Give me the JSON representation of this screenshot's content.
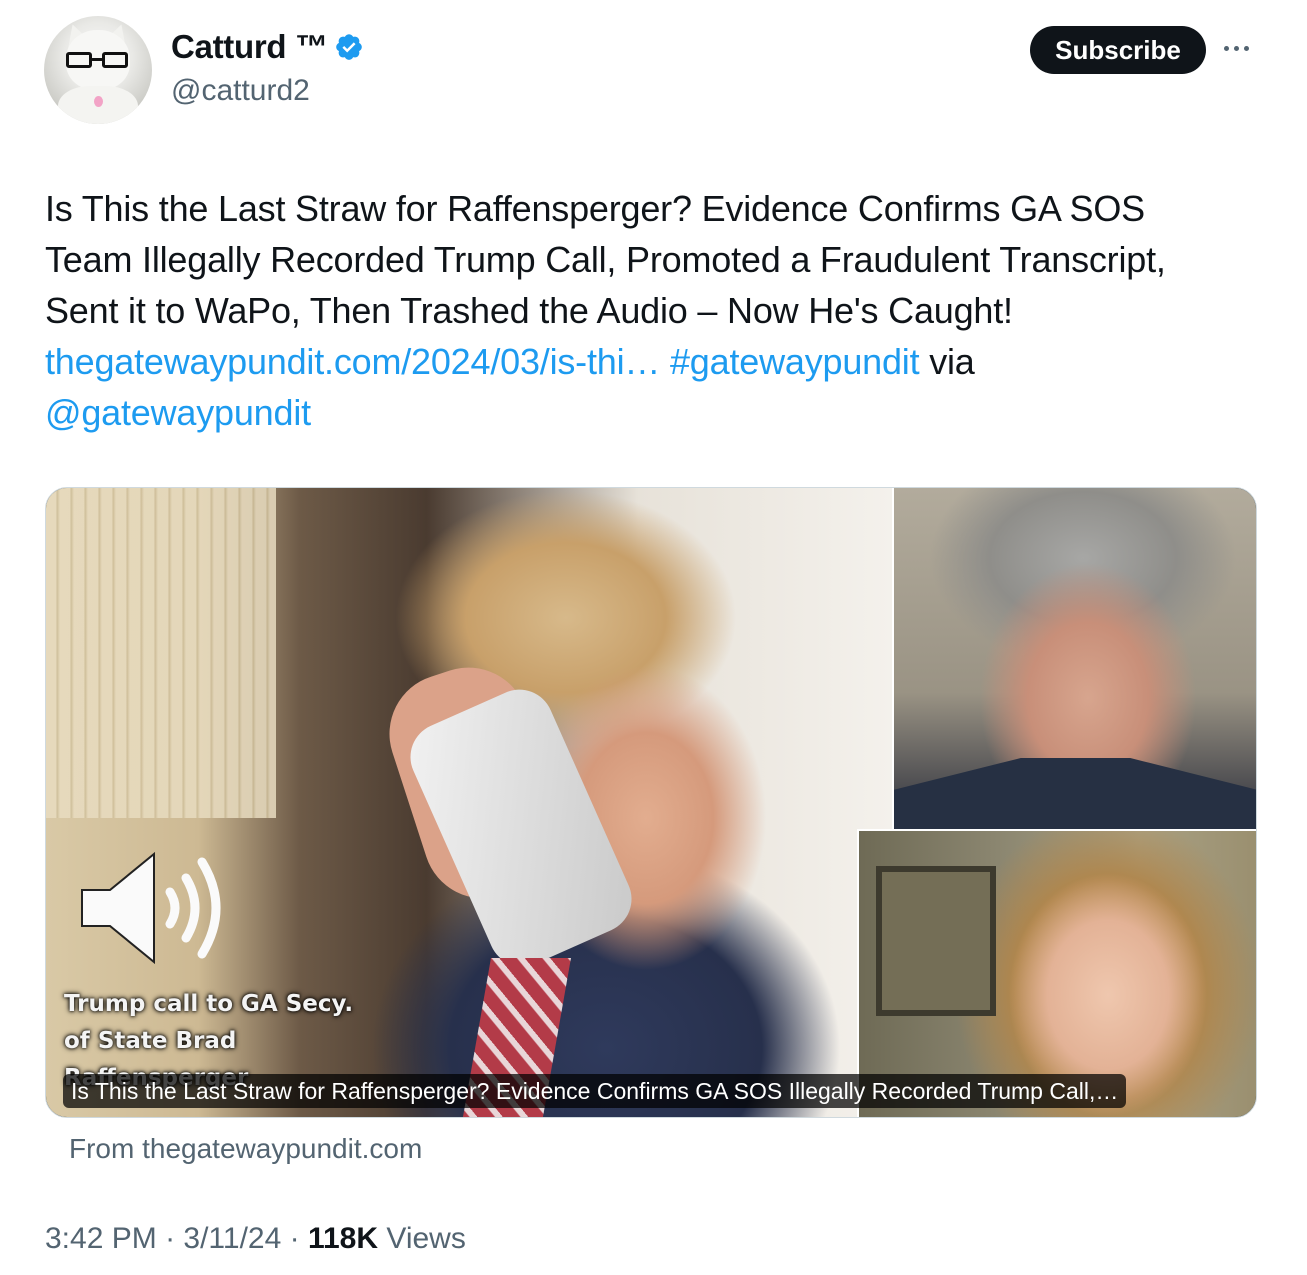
{
  "author": {
    "display_name": "Catturd ™",
    "handle": "@catturd2",
    "verified": true,
    "avatar_icon": "cat-with-glasses-avatar"
  },
  "header": {
    "subscribe_label": "Subscribe",
    "more_icon": "more-dots-icon"
  },
  "tweet": {
    "text_lines": [
      "Is This the Last Straw for Raffensperger? Evidence Confirms GA SOS",
      "Team Illegally Recorded Trump Call, Promoted a Fraudulent Transcript,",
      "Sent it to WaPo, Then Trashed the Audio – Now He's Caught!"
    ],
    "link_text": "thegatewaypundit.com/2024/03/is-thi…",
    "hashtag": "#gatewaypundit",
    "via_word": " via",
    "mention": "@gatewaypundit"
  },
  "card": {
    "image_caption": "Trump call to GA Secy. of State Brad Raffensperger",
    "title": "Is This the Last Straw for Raffensperger? Evidence Confirms GA SOS Illegally Recorded Trump Call,…",
    "source": "From thegatewaypundit.com"
  },
  "meta": {
    "time": "3:42 PM",
    "sep1": " · ",
    "date": "3/11/24",
    "sep2": " · ",
    "views_count": "118K",
    "views_label": " Views"
  },
  "colors": {
    "link": "#1d9bf0",
    "verified": "#1d9bf0",
    "secondary_text": "#536471",
    "primary_text": "#0f1419"
  }
}
